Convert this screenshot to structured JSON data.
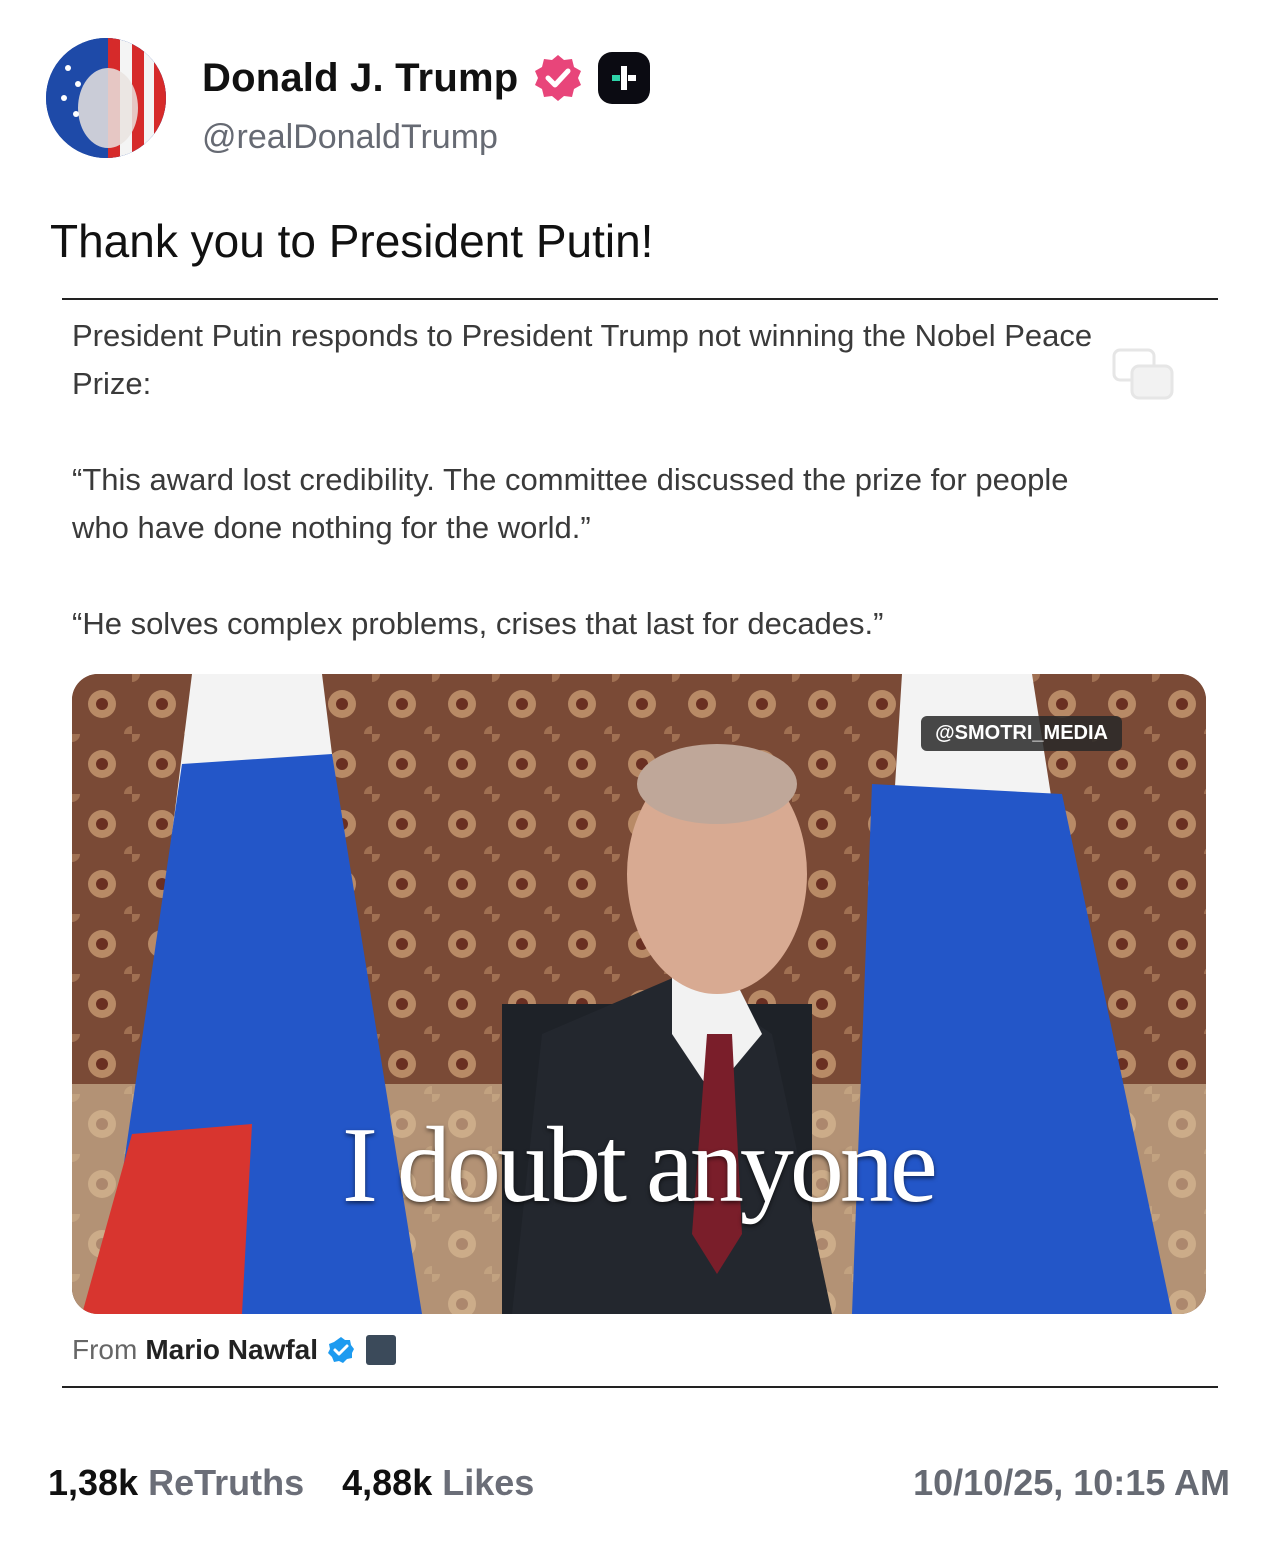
{
  "author": {
    "name": "Donald J. Trump",
    "handle": "@realDonaldTrump",
    "verified_color": "#e8457a",
    "avatar_icon": "flag-portrait-avatar",
    "badge_icon": "plus-badge-icon"
  },
  "post": {
    "text": "Thank you to President Putin!"
  },
  "quote": {
    "line1": "President Putin responds to President Trump not winning the Nobel Peace Prize:",
    "line2": "“This award lost credibility. The committee discussed the prize for people who have done nothing for the world.”",
    "line3": "“He solves complex problems, crises that last for decades.”",
    "video": {
      "watermark": "@SMOTRI_MEDIA",
      "caption": "I doubt anyone"
    },
    "from_label": "From",
    "from_name": "Mario Nawfal",
    "from_verified_color": "#1d9bf0"
  },
  "stats": {
    "retruths_count": "1,38k",
    "retruths_label": "ReTruths",
    "likes_count": "4,88k",
    "likes_label": "Likes",
    "timestamp": "10/10/25, 10:15 AM"
  }
}
